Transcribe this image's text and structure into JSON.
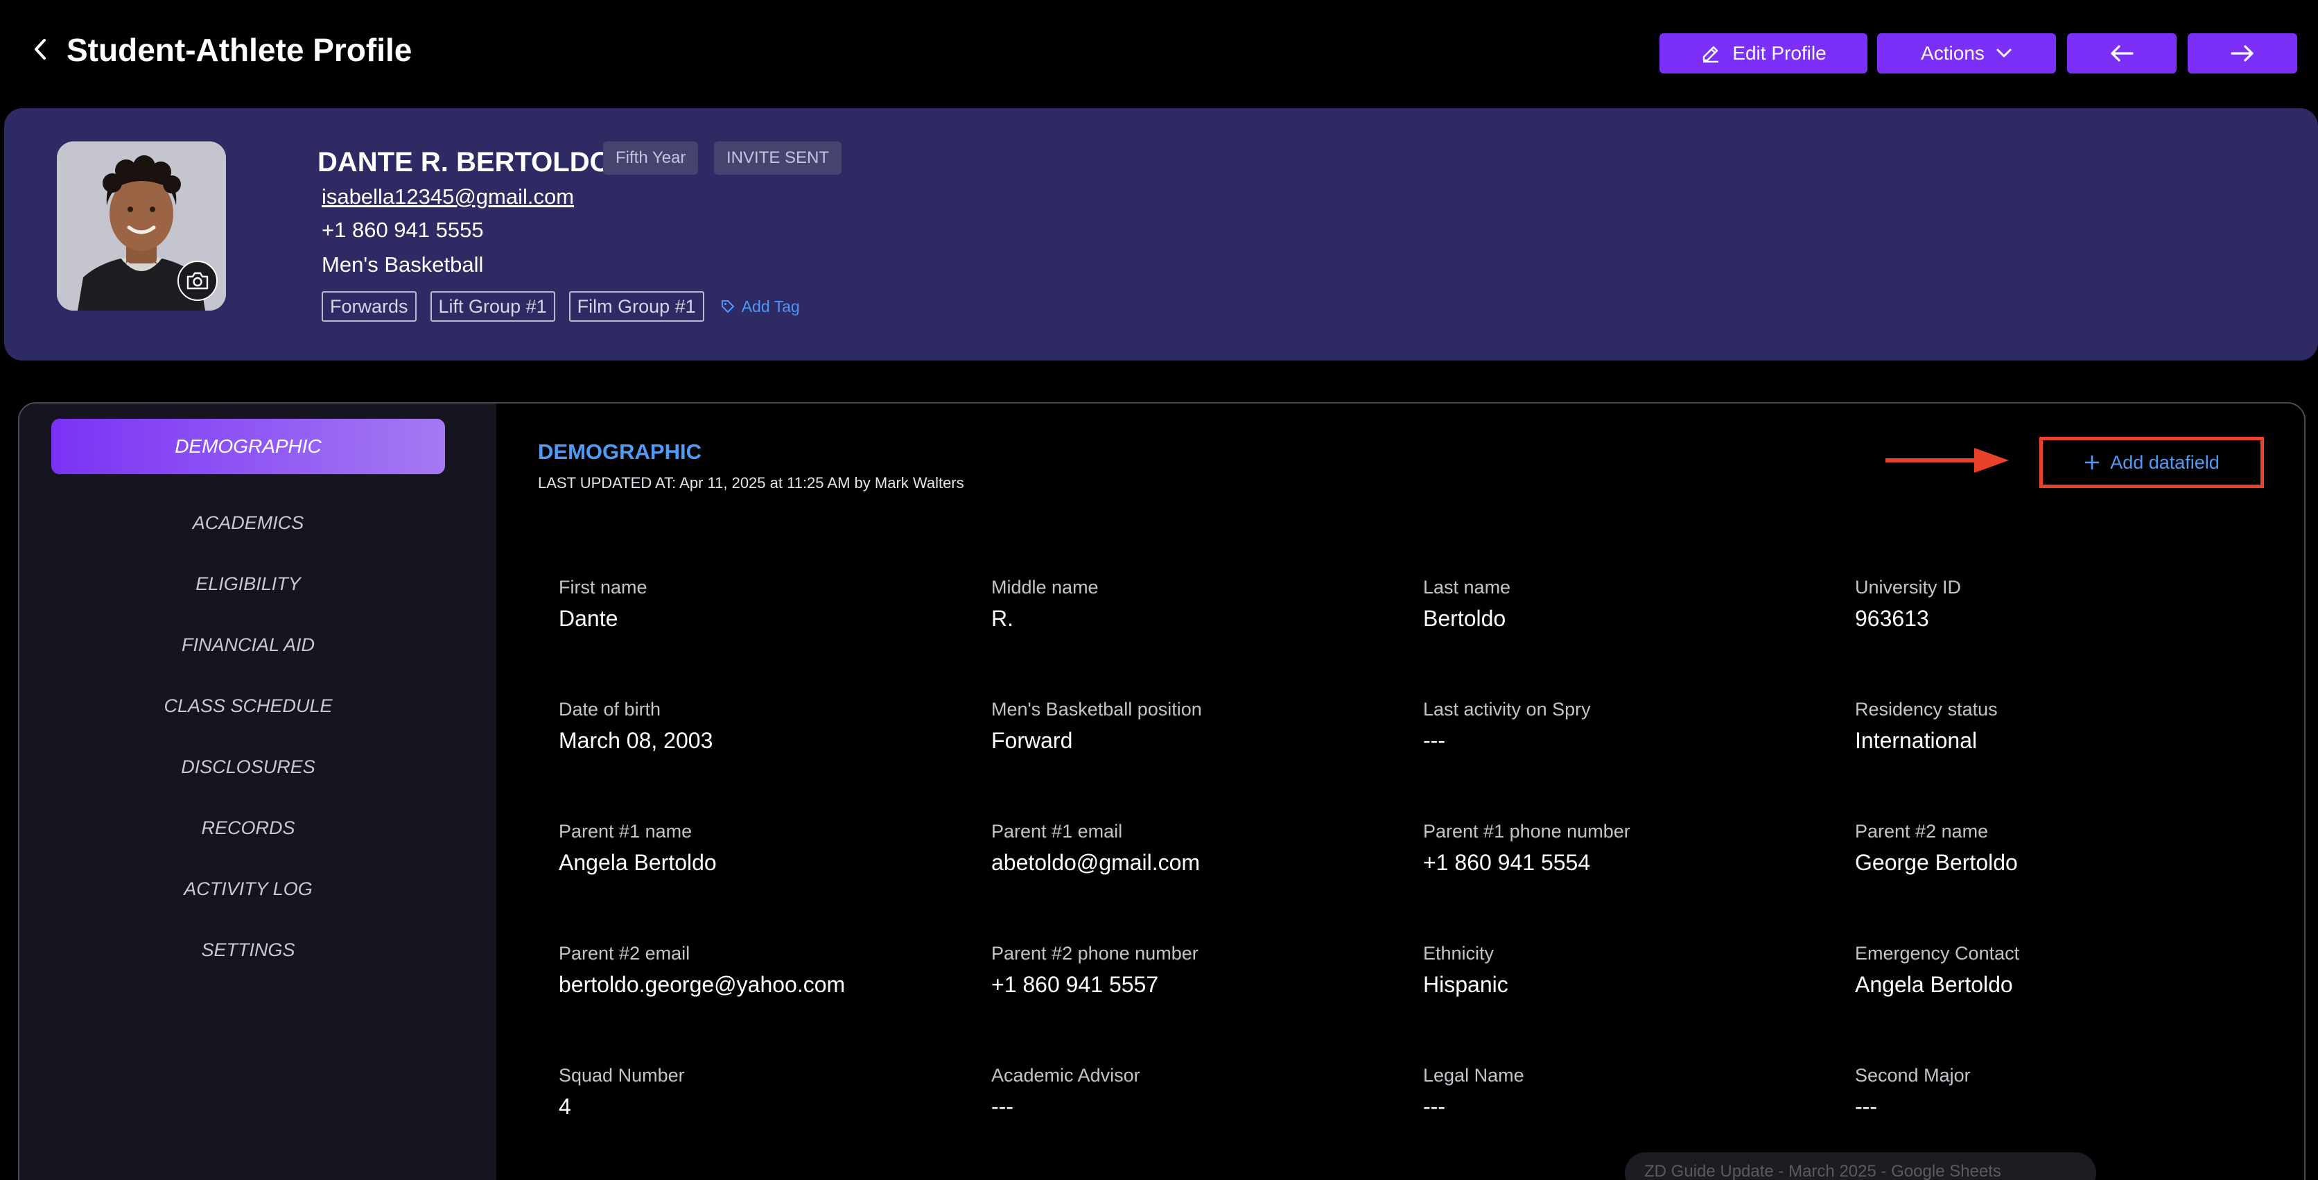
{
  "header": {
    "title": "Student-Athlete Profile",
    "edit_label": "Edit Profile",
    "actions_label": "Actions"
  },
  "athlete": {
    "name": "DANTE R. BERTOLDO",
    "year_badge": "Fifth Year",
    "status_badge": "INVITE SENT",
    "email": "isabella12345@gmail.com",
    "phone": "+1 860 941 5555",
    "team": "Men's Basketball",
    "tags": [
      "Forwards",
      "Lift Group #1",
      "Film Group #1"
    ],
    "add_tag_label": "Add Tag"
  },
  "sidebar": {
    "items": [
      {
        "label": "DEMOGRAPHIC",
        "active": true
      },
      {
        "label": "ACADEMICS"
      },
      {
        "label": "ELIGIBILITY"
      },
      {
        "label": "FINANCIAL AID"
      },
      {
        "label": "CLASS SCHEDULE"
      },
      {
        "label": "DISCLOSURES"
      },
      {
        "label": "RECORDS"
      },
      {
        "label": "ACTIVITY LOG"
      },
      {
        "label": "SETTINGS"
      }
    ]
  },
  "section": {
    "title": "DEMOGRAPHIC",
    "last_updated": "LAST UPDATED AT: Apr 11, 2025 at 11:25 AM by Mark Walters",
    "add_datafield_label": "Add datafield",
    "annotation_color": "#e8432a"
  },
  "fields": [
    {
      "label": "First name",
      "value": "Dante"
    },
    {
      "label": "Middle name",
      "value": "R."
    },
    {
      "label": "Last name",
      "value": "Bertoldo"
    },
    {
      "label": "University ID",
      "value": "963613"
    },
    {
      "label": "Date of birth",
      "value": "March 08, 2003"
    },
    {
      "label": "Men's Basketball position",
      "value": "Forward"
    },
    {
      "label": "Last activity on Spry",
      "value": "---"
    },
    {
      "label": "Residency status",
      "value": "International"
    },
    {
      "label": "Parent #1 name",
      "value": "Angela Bertoldo"
    },
    {
      "label": "Parent #1 email",
      "value": "abetoldo@gmail.com"
    },
    {
      "label": "Parent #1 phone number",
      "value": "+1 860 941 5554"
    },
    {
      "label": "Parent #2 name",
      "value": "George Bertoldo"
    },
    {
      "label": "Parent #2 email",
      "value": "bertoldo.george@yahoo.com"
    },
    {
      "label": "Parent #2 phone number",
      "value": "+1 860 941 5557"
    },
    {
      "label": "Ethnicity",
      "value": "Hispanic"
    },
    {
      "label": "Emergency Contact",
      "value": "Angela Bertoldo"
    },
    {
      "label": "Squad Number",
      "value": "4"
    },
    {
      "label": "Academic Advisor",
      "value": "---"
    },
    {
      "label": "Legal Name",
      "value": "---"
    },
    {
      "label": "Second Major",
      "value": "---"
    }
  ],
  "toast": {
    "text": "ZD Guide Update - March 2025 - Google Sheets"
  },
  "colors": {
    "accent": "#7b2ff7",
    "profile_bg": "#2e2a64",
    "link_blue": "#4f9bf7"
  }
}
